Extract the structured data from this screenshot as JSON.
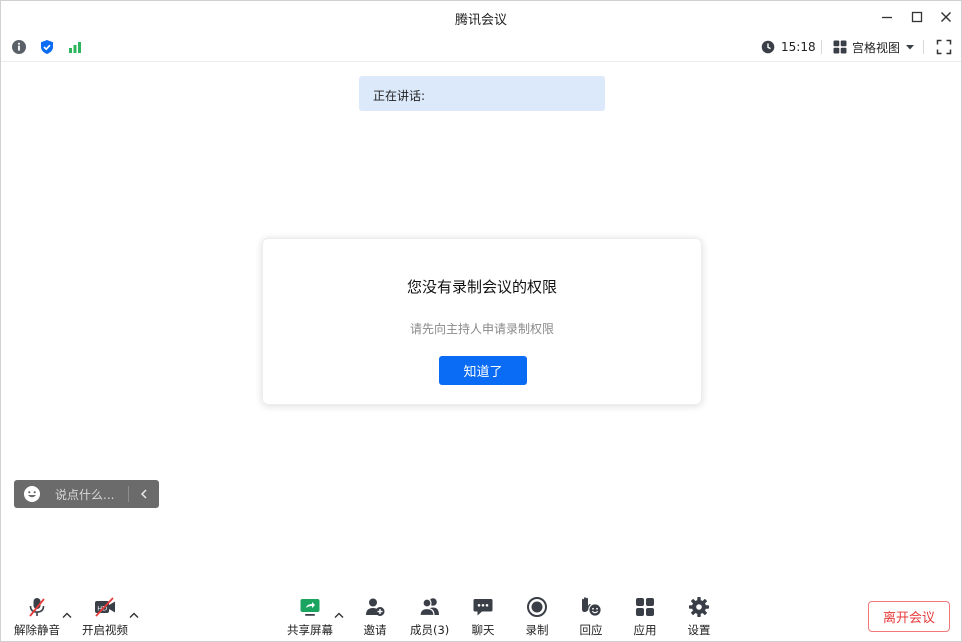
{
  "window": {
    "title": "腾讯会议"
  },
  "statusbar": {
    "time": "15:18",
    "view_mode": "宫格视图"
  },
  "speaking": {
    "label": "正在讲话:"
  },
  "dialog": {
    "title": "您没有录制会议的权限",
    "message": "请先向主持人申请录制权限",
    "confirm_label": "知道了"
  },
  "chat": {
    "placeholder": "说点什么..."
  },
  "toolbar": {
    "unmute_label": "解除静音",
    "video_label": "开启视频",
    "share_label": "共享屏幕",
    "invite_label": "邀请",
    "members_label": "成员(3)",
    "chat_label": "聊天",
    "record_label": "录制",
    "reaction_label": "回应",
    "apps_label": "应用",
    "settings_label": "设置",
    "leave_label": "离开会议"
  },
  "colors": {
    "accent": "#0a6cf5",
    "banner_bg": "#dce9fb",
    "danger": "#e83a3a",
    "signal": "#2db55d",
    "share_icon": "#1ba360"
  }
}
